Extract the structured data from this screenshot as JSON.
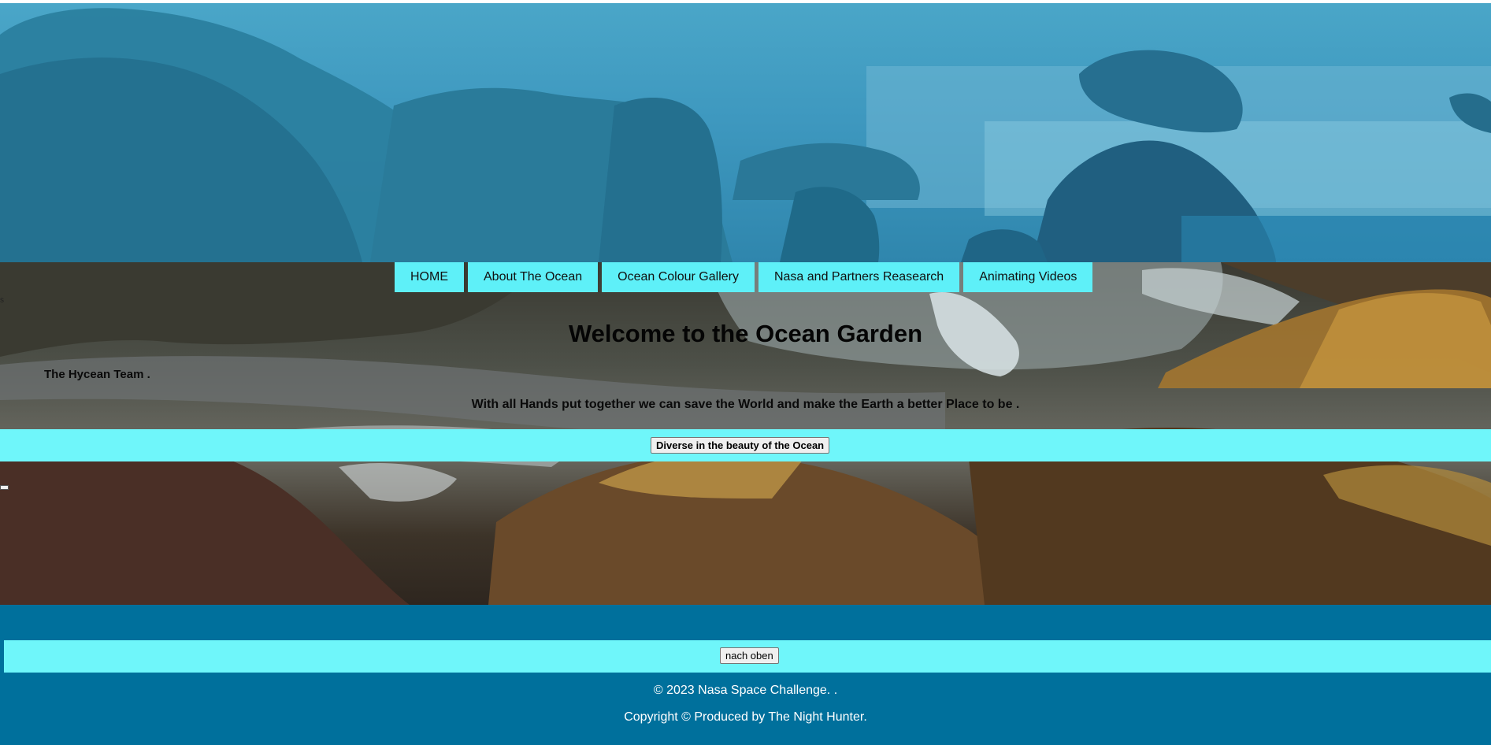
{
  "nav": {
    "items": [
      "HOME",
      "About The Ocean",
      "Ocean Colour Gallery",
      "Nasa and Partners Reasearch",
      "Animating Videos"
    ]
  },
  "hero": {
    "title": "Welcome to the Ocean Garden",
    "team": "The Hycean Team .",
    "tagline": "With all Hands put together we can save the World and make the Earth a better Place to be ."
  },
  "cta": {
    "button_label": "Diverse in the beauty of the Ocean"
  },
  "footer": {
    "back_to_top_label": "nach oben",
    "copyright_line1": "© 2023 Nasa Space Challenge. .",
    "copyright_line2": "Copyright © Produced by The Night Hunter."
  },
  "colors": {
    "nav_bg": "#5ef0f8",
    "band_bg": "#6ff6fa",
    "footer_bg": "#00709c"
  }
}
